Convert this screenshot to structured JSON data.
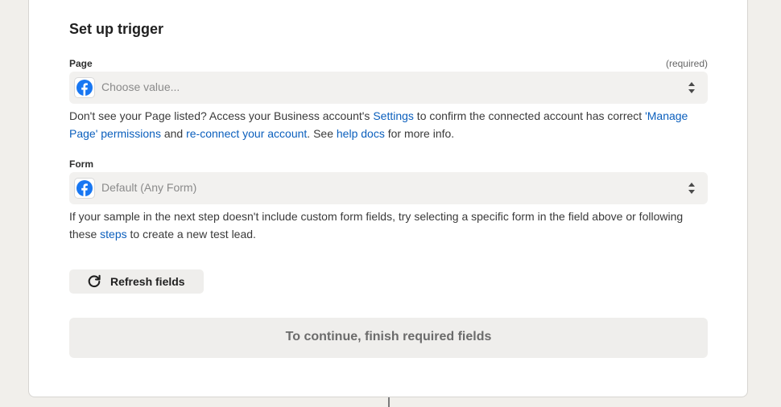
{
  "section": {
    "title": "Set up trigger"
  },
  "page_field": {
    "label": "Page",
    "required_note": "(required)",
    "value": "Choose value...",
    "icon": "facebook-icon",
    "help": {
      "t1": "Don't see your Page listed? Access your Business account's ",
      "link_settings": "Settings",
      "t2": " to confirm the connected account has correct ",
      "link_manage": "'Manage Page' permissions",
      "t3": " and ",
      "link_reconnect": "re-connect your account",
      "t4": ". See ",
      "link_docs": "help docs",
      "t5": " for more info."
    }
  },
  "form_field": {
    "label": "Form",
    "value": "Default (Any Form)",
    "icon": "facebook-icon",
    "help": {
      "t1": "If your sample in the next step doesn't include custom form fields, try selecting a specific form in the field above or following these ",
      "link_steps": "steps",
      "t2": " to create a new test lead."
    }
  },
  "refresh_button": {
    "label": "Refresh fields",
    "icon": "refresh-icon"
  },
  "continue_button": {
    "label": "To continue, finish required fields"
  },
  "colors": {
    "link": "#0b5fbd",
    "facebook": "#1877f2",
    "field_bg": "#f2f1ef",
    "page_bg": "#f1efeb"
  }
}
